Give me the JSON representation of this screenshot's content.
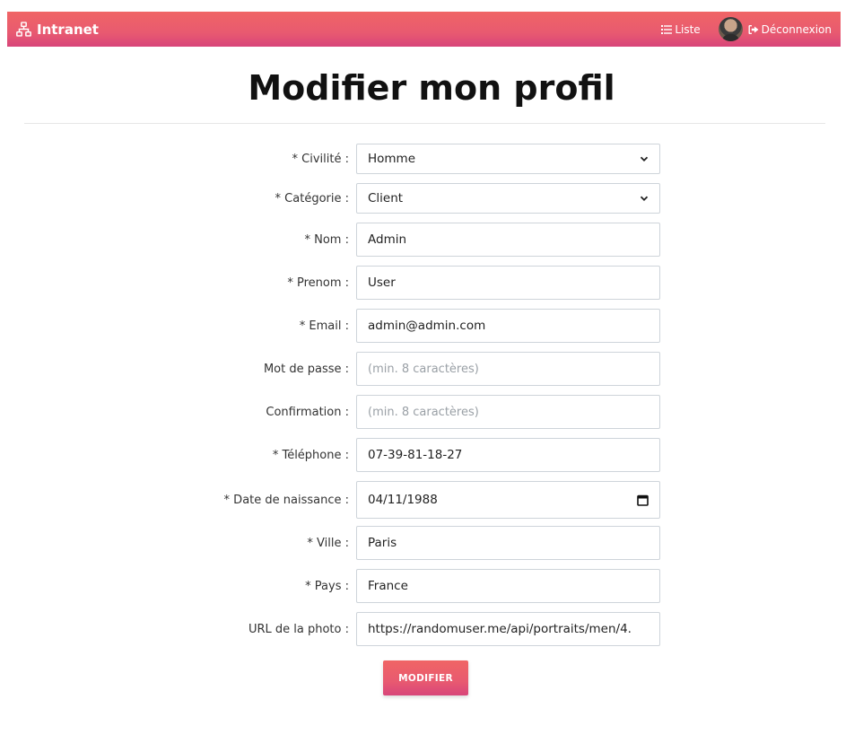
{
  "navbar": {
    "brand": "Intranet",
    "list_label": "Liste",
    "logout_label": "Déconnexion"
  },
  "page": {
    "title": "Modifier mon profil"
  },
  "form": {
    "civilite": {
      "label": "* Civilité :",
      "value": "Homme"
    },
    "categorie": {
      "label": "* Catégorie :",
      "value": "Client"
    },
    "nom": {
      "label": "* Nom :",
      "value": "Admin"
    },
    "prenom": {
      "label": "* Prenom :",
      "value": "User"
    },
    "email": {
      "label": "* Email :",
      "value": "admin@admin.com"
    },
    "password": {
      "label": "Mot de passe :",
      "placeholder": "(min. 8 caractères)"
    },
    "confirmation": {
      "label": "Confirmation :",
      "placeholder": "(min. 8 caractères)"
    },
    "telephone": {
      "label": "* Téléphone :",
      "value": "07-39-81-18-27"
    },
    "naissance": {
      "label": "* Date de naissance :",
      "value": "04/11/1988"
    },
    "ville": {
      "label": "* Ville :",
      "value": "Paris"
    },
    "pays": {
      "label": "* Pays :",
      "value": "France"
    },
    "photo": {
      "label": "URL de la photo :",
      "value": "https://randomuser.me/api/portraits/men/4."
    },
    "submit_label": "MODIFIER"
  },
  "colors": {
    "accent_top": "#f06565",
    "accent_bottom": "#d8457a"
  }
}
